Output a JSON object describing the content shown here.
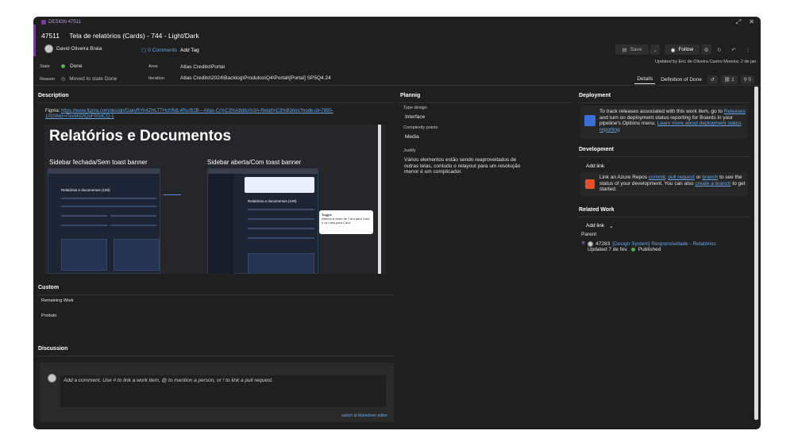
{
  "header": {
    "type_label": "DESIGN 47511",
    "work_item_id": "47511",
    "title": "Tela de relatórios (Cards) - 744 - Light/Dark",
    "assignee": "David Oliveira Braia",
    "comments_label": "0 Comments",
    "add_tag_label": "Add Tag",
    "save_label": "Save",
    "follow_label": "Follow",
    "updated_text": "Updated by Eric de Oliveira Castro Moreira: 2 de jan."
  },
  "fields": {
    "state_label": "State",
    "state_value": "Done",
    "area_label": "Area",
    "area_value": "Atlas Credito\\Portal",
    "reason_label": "Reason",
    "reason_value": "Moved to state Done",
    "iteration_label": "Iteration",
    "iteration_value": "Atlas Credito\\2024\\Backlog\\Produtos\\Q4\\Portal\\[Portal] SP5Q4.24"
  },
  "detail_tabs": {
    "details": "Details",
    "definition_of_done": "Definition of Done",
    "links_count": "1",
    "attachments_count": "0"
  },
  "description": {
    "heading": "Description",
    "figma_prefix": "Figma: ",
    "figma_url": "https://www.figma.com/design/DakvRYh4ZHLTTHchRdL4Ru/B2B---Atlas-Cr%C3%A9dito%3A-Relat%C3%B3rios?node-id=7850-10156&t=lTexMd2tQoF9SdCQ-1",
    "embed_title": "Relatórios e Documentos",
    "embed_left_caption": "Sidebar fechada/Sem toast banner",
    "embed_right_caption": "Sidebar aberta/Com toast banner",
    "embed_screen_heading": "Relatórios e documentos (100)",
    "embed_tooltip_title": "Toggle",
    "embed_tooltip_text": "Alterna a visão de Card para Lista e vs Lista para Card."
  },
  "custom": {
    "heading": "Custom",
    "remaining_work_label": "Remaining Work",
    "produto_label": "Produto"
  },
  "discussion": {
    "heading": "Discussion",
    "placeholder": "Add a comment. Use # to link a work item, @ to mention a person, or ! to link a pull request.",
    "markdown_link": "switch to Markdown editor"
  },
  "planning": {
    "heading": "Plannig",
    "type_design_label": "Type design",
    "type_design_value": "Interface",
    "complexity_label": "Complexity points",
    "complexity_value": "Media",
    "justify_label": "Justify",
    "justify_value": "Vários elementos estão sendo reaproveitados de outras telas, contudo o relayout para um resolução menor é um complicador."
  },
  "deployment": {
    "heading": "Deployment",
    "text_1": "To track releases associated with this work item, go to",
    "releases_link": "Releases",
    "text_2": "and turn on deployment status reporting for Boards in your pipeline's Options menu.",
    "learn_more_link": "Learn more about deployment status reporting"
  },
  "development": {
    "heading": "Development",
    "add_link_label": "Add link",
    "text_1": "Link an Azure Repos",
    "commit_link": "commit",
    "pull_request_link": "pull request",
    "or": "or",
    "branch_link": "branch",
    "text_2": "to see the status of your development. You can also",
    "create_branch_link": "create a branch",
    "text_3": "to get started."
  },
  "related": {
    "heading": "Related Work",
    "add_link_label": "Add link",
    "parent_label": "Parent",
    "item_id": "47283",
    "item_title": "[Design System] Responsividade - Relatórios",
    "item_updated": "Updated 7 de fev.",
    "item_state": "Published"
  },
  "colors": {
    "background": "#1f1f1f",
    "accent_purple": "#773b93",
    "link_blue": "#6aa7e6",
    "done_green": "#4caf50"
  }
}
